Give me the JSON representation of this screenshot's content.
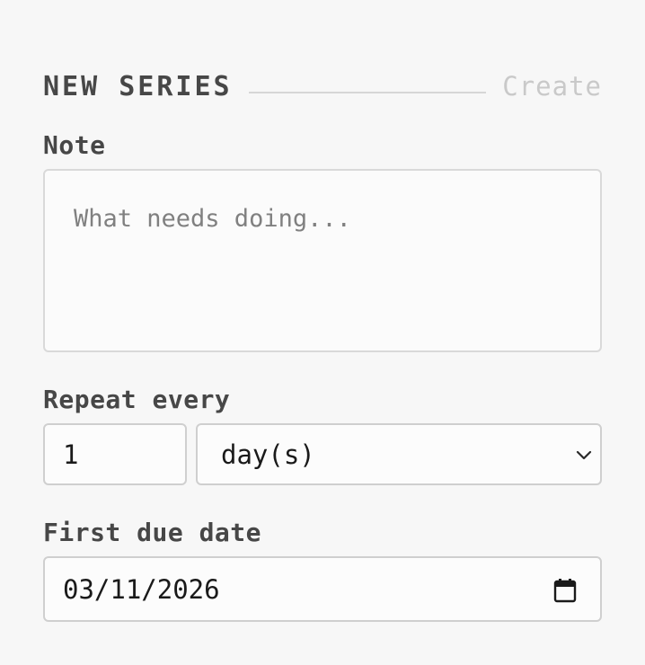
{
  "header": {
    "title": "NEW SERIES",
    "create_label": "Create"
  },
  "note": {
    "label": "Note",
    "placeholder": "What needs doing..."
  },
  "repeat": {
    "label": "Repeat every",
    "count_value": "1",
    "unit_selected": "day(s)"
  },
  "due": {
    "label": "First due date",
    "value": "03/11/2026"
  },
  "icons": {
    "select_arrow": "chevron-down-icon",
    "date_picker": "calendar-icon"
  }
}
